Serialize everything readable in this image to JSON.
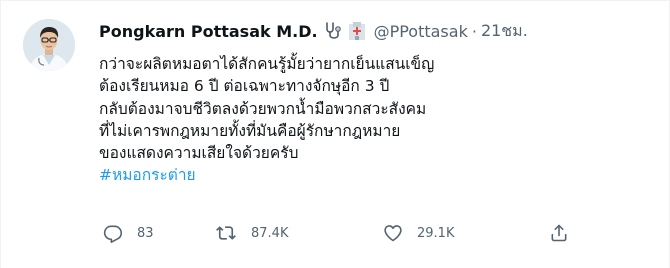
{
  "author": {
    "name": "Pongkarn Pottasak M.D.",
    "emoji": [
      "stethoscope-icon",
      "hospital-icon"
    ],
    "handle": "@PPottasak",
    "separator": "·",
    "time": "21ชม."
  },
  "tweet": {
    "lines": [
      "กว่าจะผลิตหมอตาได้สักคนรู้มั้ยว่ายากเย็นแสนเข็ญ",
      "ต้องเรียนหมอ 6 ปี ต่อเฉพาะทางจักษุอีก 3 ปี",
      "กลับต้องมาจบชีวิตลงด้วยพวกน้ำมือพวกสวะสังคม",
      "ที่ไม่เคารพกฎหมายทั้งที่มันคือผู้รักษากฎหมาย",
      "ของแสดงความเสียใจด้วยครับ"
    ],
    "hashtag": "#หมอกระต่าย"
  },
  "actions": {
    "replies": "83",
    "retweets": "87.4K",
    "likes": "29.1K"
  },
  "colors": {
    "text": "#0f1419",
    "secondary": "#536471",
    "link": "#1d9bf0"
  }
}
